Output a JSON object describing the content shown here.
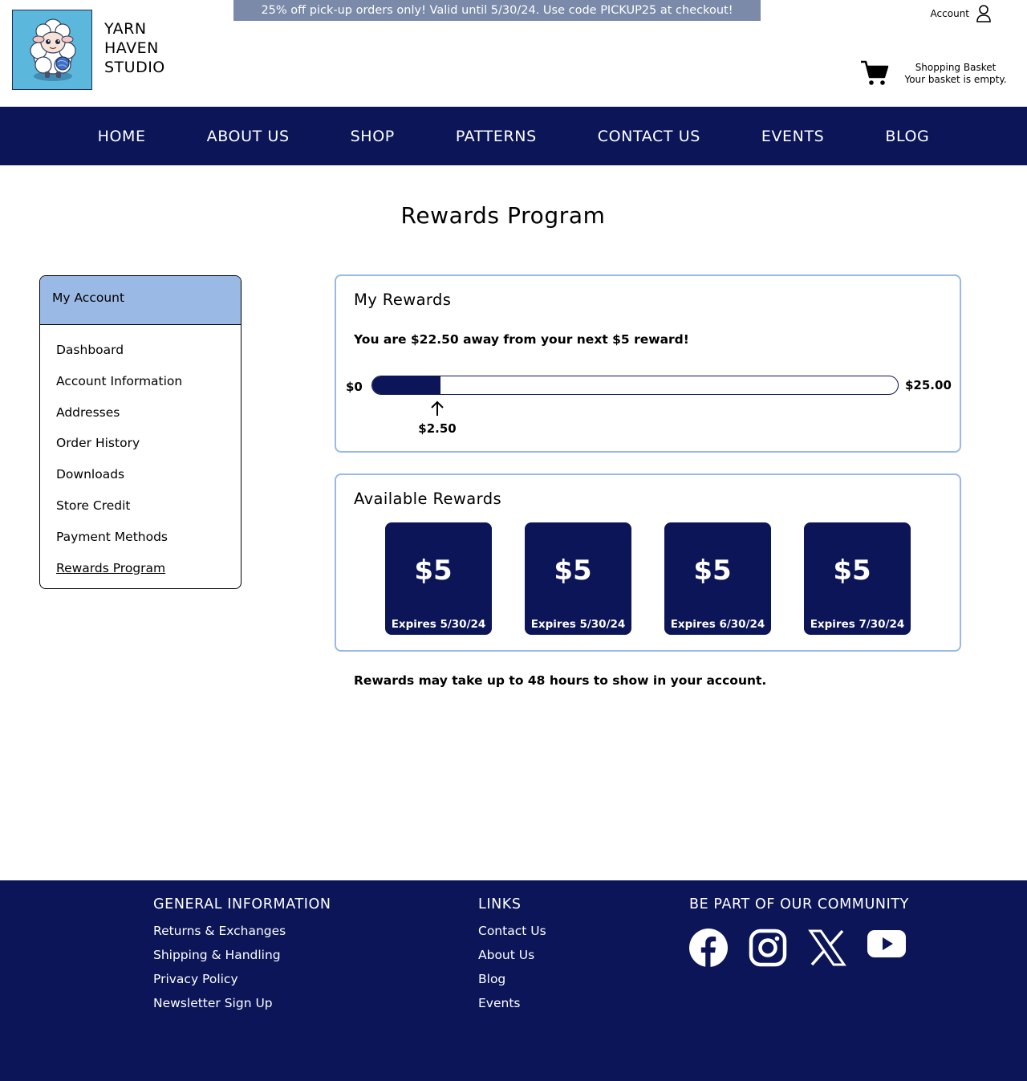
{
  "header": {
    "brand_lines": [
      "YARN",
      "HAVEN",
      "STUDIO"
    ],
    "promo": "25% off pick-up orders only! Valid until 5/30/24. Use code PICKUP25 at checkout!",
    "account_label": "Account",
    "basket_title": "Shopping Basket",
    "basket_status": "Your basket is empty."
  },
  "nav": [
    "HOME",
    "ABOUT US",
    "SHOP",
    "PATTERNS",
    "CONTACT US",
    "EVENTS",
    "BLOG"
  ],
  "page_title": "Rewards Program",
  "sidebar": {
    "title": "My Account",
    "items": [
      "Dashboard",
      "Account Information",
      "Addresses",
      "Order History",
      "Downloads",
      "Store Credit",
      "Payment Methods",
      "Rewards Program"
    ],
    "active": "Rewards Program"
  },
  "my_rewards": {
    "title": "My Rewards",
    "message": "You are $22.50 away from your next $5 reward!",
    "start_label": "$0",
    "end_label": "$25.00",
    "current_label": "$2.50",
    "progress_fraction": 0.1
  },
  "available": {
    "title": "Available Rewards",
    "cards": [
      {
        "amount": "$5",
        "expires": "Expires 5/30/24"
      },
      {
        "amount": "$5",
        "expires": "Expires 5/30/24"
      },
      {
        "amount": "$5",
        "expires": "Expires 6/30/24"
      },
      {
        "amount": "$5",
        "expires": "Expires 7/30/24"
      }
    ]
  },
  "note": "Rewards may take up to 48 hours to show in your account.",
  "footer": {
    "general": {
      "title": "GENERAL INFORMATION",
      "links": [
        "Returns & Exchanges",
        "Shipping & Handling",
        "Privacy Policy",
        "Newsletter Sign Up"
      ]
    },
    "links": {
      "title": "LINKS",
      "links": [
        "Contact Us",
        "About Us",
        "Blog",
        "Events"
      ]
    },
    "community": {
      "title": "BE PART OF OUR COMMUNITY",
      "icons": [
        "facebook-icon",
        "instagram-icon",
        "x-icon",
        "youtube-icon"
      ]
    }
  },
  "colors": {
    "navy": "#0b1557",
    "panel_border": "#9ab9e4",
    "promo_bg": "#7a8aa8",
    "logo_bg": "#5bb8dc"
  }
}
